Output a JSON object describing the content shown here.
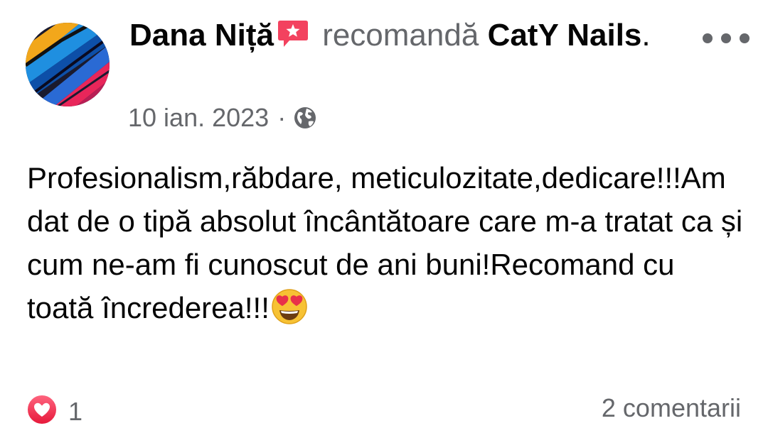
{
  "post": {
    "author_name": "Dana Niță",
    "verb": "recomandă",
    "page_name": "CatY Nails",
    "period": ".",
    "date": "10 ian. 2023",
    "separator": "·",
    "privacy_icon": "globe-icon",
    "badge_icon": "recommend-badge-icon",
    "body_text": "Profesionalism,răbdare, meticulozitate,dedicare!!!Am dat de o tipă absolut încântătoare care m-a tratat ca și cum ne-am fi cunoscut de ani buni!Recomand cu toată încrederea!!!",
    "emoji_icon": "heart-eyes-emoji"
  },
  "actions": {
    "more_icon": "more-options-icon"
  },
  "footer": {
    "reaction_icon": "love-reaction-icon",
    "reaction_count": "1",
    "comments_label": "2 comentarii"
  },
  "colors": {
    "text_primary": "#050505",
    "text_secondary": "#65676b",
    "badge_pink": "#f3425f",
    "reaction_red": "#f33e58"
  }
}
